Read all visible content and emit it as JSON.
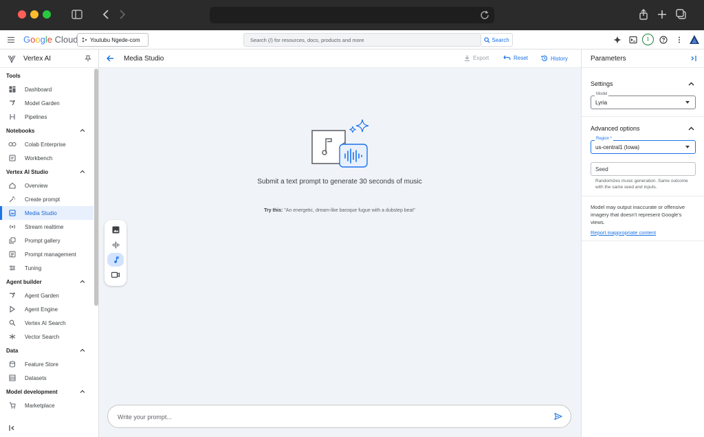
{
  "header": {
    "project": "Youtubu Ngede-com",
    "search_placeholder": "Search (/) for resources, docs, products and more",
    "search_button": "Search",
    "notification_count": "1"
  },
  "sidebar": {
    "product_title": "Vertex AI",
    "sections": [
      {
        "label": "Tools",
        "items": [
          "Dashboard",
          "Model Garden",
          "Pipelines"
        ]
      },
      {
        "label": "Notebooks",
        "items": [
          "Colab Enterprise",
          "Workbench"
        ]
      },
      {
        "label": "Vertex AI Studio",
        "items": [
          "Overview",
          "Create prompt",
          "Media Studio",
          "Stream realtime",
          "Prompt gallery",
          "Prompt management",
          "Tuning"
        ]
      },
      {
        "label": "Agent builder",
        "items": [
          "Agent Garden",
          "Agent Engine",
          "Vertex AI Search",
          "Vector Search"
        ]
      },
      {
        "label": "Data",
        "items": [
          "Feature Store",
          "Datasets"
        ]
      },
      {
        "label": "Model development",
        "items": [
          "Marketplace"
        ]
      }
    ],
    "active_item": "Media Studio"
  },
  "main": {
    "title": "Media Studio",
    "export_label": "Export",
    "reset_label": "Reset",
    "history_label": "History",
    "hero_text": "Submit a text prompt to generate 30 seconds of music",
    "try_label": "Try this:",
    "try_example": "\"An energetic, dream-like baroque fugue with a dubstep beat\"",
    "prompt_placeholder": "Write your prompt..."
  },
  "parameters": {
    "title": "Parameters",
    "settings_label": "Settings",
    "model_label": "Model",
    "model_value": "Lyria",
    "advanced_label": "Advanced options",
    "region_label": "Region *",
    "region_value": "us-central1 (Iowa)",
    "seed_placeholder": "Seed",
    "seed_helper": "Randomizes music generation. Same outcome with the same seed and inputs.",
    "notice": "Model may output inaccurate or offensive imagery that doesn't represent Google's views.",
    "report_link": "Report inappropriate content"
  },
  "colors": {
    "accent": "#1a73e8",
    "active_bg": "#e8f0fe",
    "canvas_bg": "#f0f3f8"
  }
}
